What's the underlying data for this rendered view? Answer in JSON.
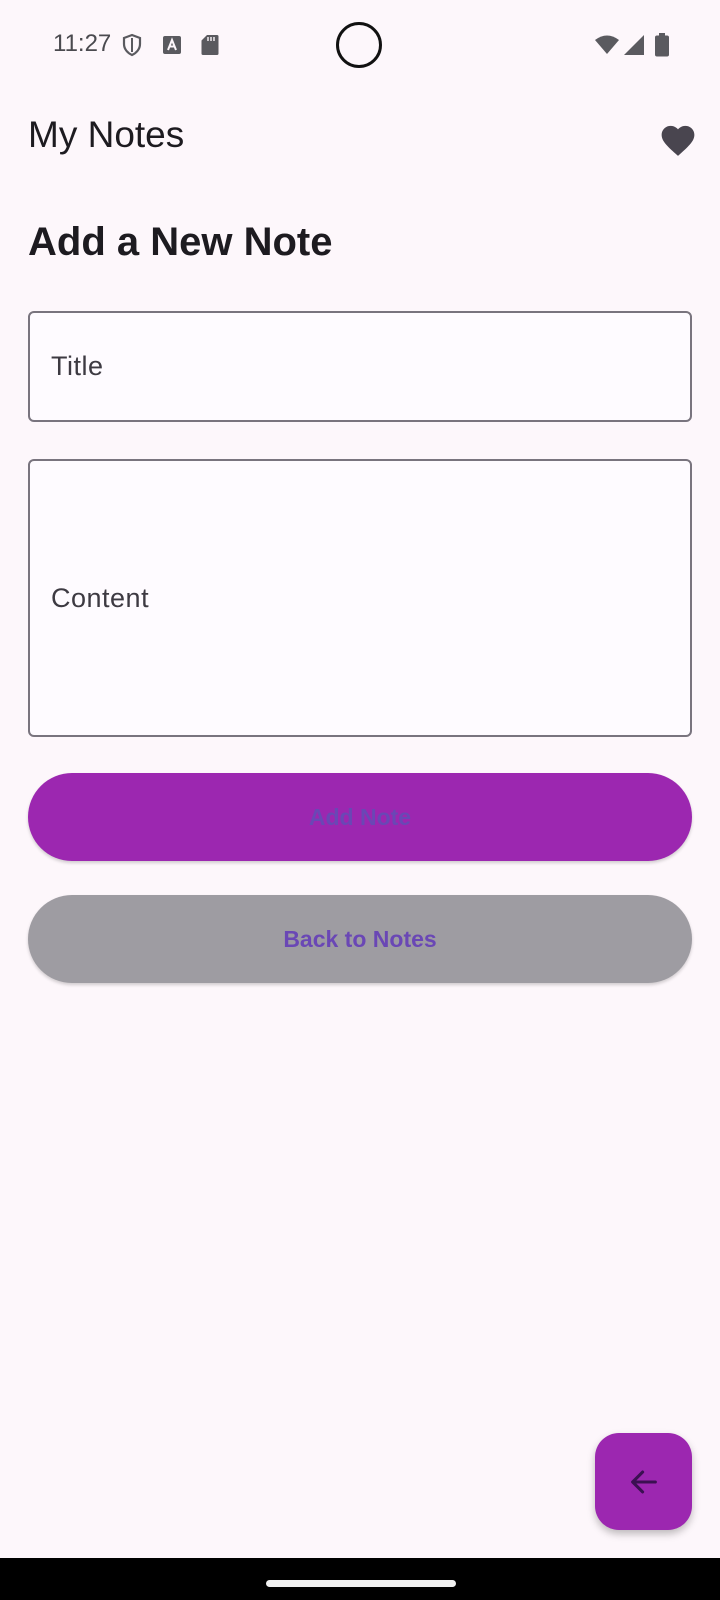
{
  "status_bar": {
    "time": "11:27",
    "icons": [
      "shield-icon",
      "keyboard-a-icon",
      "sd-card-icon",
      "wifi-icon",
      "signal-icon",
      "battery-icon"
    ]
  },
  "app_bar": {
    "title": "My Notes",
    "action_icon": "heart-icon"
  },
  "page": {
    "heading": "Add a New Note"
  },
  "form": {
    "title_label": "Title",
    "content_label": "Content"
  },
  "buttons": {
    "add_note": "Add Note",
    "back_to_notes": "Back to Notes"
  },
  "fab": {
    "icon": "arrow-left-icon"
  },
  "colors": {
    "background": "#fdf7fb",
    "primary": "#9c27b0",
    "button_text": "#6a47b5",
    "secondary_button": "#9e9ca2",
    "outline": "#79747e"
  }
}
